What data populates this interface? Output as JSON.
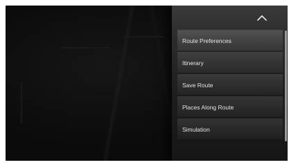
{
  "menu": {
    "items": [
      {
        "label": "Route Preferences"
      },
      {
        "label": "Itinerary"
      },
      {
        "label": "Save Route"
      },
      {
        "label": "Places Along Route"
      },
      {
        "label": "Simulation"
      }
    ]
  },
  "collapse_button": {
    "icon": "chevron-up-icon"
  }
}
